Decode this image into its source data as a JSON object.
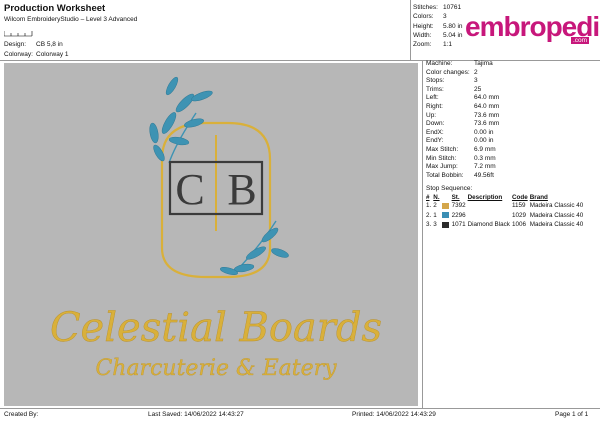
{
  "header": {
    "title": "Production Worksheet",
    "subtitle": "Wilcom EmbroideryStudio – Level 3 Advanced",
    "design_label": "Design:",
    "design_value": "CB 5,8 in",
    "colorway_label": "Colorway:",
    "colorway_value": "Colorway 1"
  },
  "stats": [
    {
      "label": "Stitches:",
      "value": "10761"
    },
    {
      "label": "Colors:",
      "value": "3"
    },
    {
      "label": "Height:",
      "value": "5.80 in"
    },
    {
      "label": "Width:",
      "value": "5.04 in"
    },
    {
      "label": "Zoom:",
      "value": "1:1"
    }
  ],
  "brand": {
    "logo": "embropedia",
    "logo_sub": ".com",
    "color": "#c7177b"
  },
  "machine_info": [
    {
      "label": "Machine:",
      "value": "Tajima"
    },
    {
      "label": "Color changes:",
      "value": "2"
    },
    {
      "label": "Stops:",
      "value": "3"
    },
    {
      "label": "Trims:",
      "value": "25"
    },
    {
      "label": "Left:",
      "value": "64.0 mm"
    },
    {
      "label": "Right:",
      "value": "64.0 mm"
    },
    {
      "label": "Up:",
      "value": "73.6 mm"
    },
    {
      "label": "Down:",
      "value": "73.6 mm"
    },
    {
      "label": "EndX:",
      "value": "0.00 in"
    },
    {
      "label": "EndY:",
      "value": "0.00 in"
    },
    {
      "label": "Max Stitch:",
      "value": "6.9 mm"
    },
    {
      "label": "Min Stitch:",
      "value": "0.3 mm"
    },
    {
      "label": "Max Jump:",
      "value": "7.2 mm"
    },
    {
      "label": "Total Bobbin:",
      "value": "49.56ft"
    }
  ],
  "stop_sequence": {
    "title": "Stop Sequence:",
    "headers": [
      "#",
      "N.",
      "St.",
      "Description",
      "Code",
      "Brand"
    ],
    "rows": [
      {
        "num": "1.",
        "n": "2",
        "swatch": "#d4a64a",
        "st": "7392",
        "desc": "",
        "code": "1159",
        "brand": "Madeira Classic 40"
      },
      {
        "num": "2.",
        "n": "1",
        "swatch": "#3b8fb5",
        "st": "2296",
        "desc": "",
        "code": "1029",
        "brand": "Madeira Classic 40"
      },
      {
        "num": "3.",
        "n": "3",
        "swatch": "#2b2b2b",
        "st": "1071",
        "desc": "Diamond Black",
        "code": "1006",
        "brand": "Madeira Classic 40"
      }
    ]
  },
  "design": {
    "monogram_left": "C",
    "monogram_right": "B",
    "script_line1": "Celestial Boards",
    "script_line2": "Charcuterie & Eatery",
    "gold": "#d9b03a",
    "teal": "#3e93b3",
    "black": "#3b3b3b",
    "background": "#b7b7b7"
  },
  "footer": {
    "created_by": "Created By:",
    "last_saved": "Last Saved: 14/06/2022 14:43:27",
    "printed": "Printed: 14/06/2022 14:43:29",
    "page": "Page 1 of 1"
  }
}
